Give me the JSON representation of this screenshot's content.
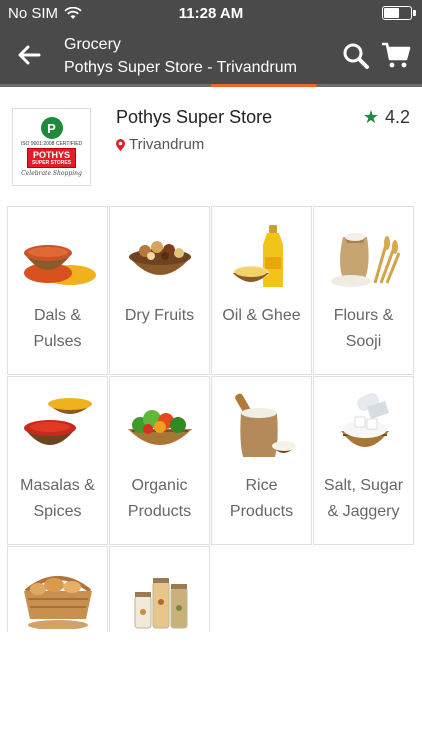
{
  "status_bar": {
    "carrier": "No SIM",
    "time": "11:28 AM"
  },
  "nav": {
    "title": "Grocery",
    "subtitle": "Pothys Super Store - Trivandrum"
  },
  "store": {
    "name": "Pothys Super Store",
    "location": "Trivandrum",
    "rating": "4.2",
    "logo": {
      "iso_text": "ISO 9001:2008 CERTIFIED",
      "brand": "POTHYS",
      "brand_sub": "SUPER STORES",
      "tagline": "Celebrate Shopping"
    }
  },
  "categories": [
    {
      "line1": "Dals &",
      "line2": "Pulses",
      "icon": "dals-icon"
    },
    {
      "line1": "Dry Fruits",
      "line2": "",
      "icon": "dry-fruits-icon"
    },
    {
      "line1": "Oil & Ghee",
      "line2": "",
      "icon": "oil-ghee-icon"
    },
    {
      "line1": "Flours &",
      "line2": "Sooji",
      "icon": "flour-icon"
    },
    {
      "line1": "Masalas &",
      "line2": "Spices",
      "icon": "masala-icon"
    },
    {
      "line1": "Organic",
      "line2": "Products",
      "icon": "organic-icon"
    },
    {
      "line1": "Rice",
      "line2": "Products",
      "icon": "rice-icon"
    },
    {
      "line1": "Salt, Sugar",
      "line2": "& Jaggery",
      "icon": "salt-sugar-icon"
    },
    {
      "line1": "",
      "line2": "",
      "icon": "bakery-icon"
    },
    {
      "line1": "",
      "line2": "",
      "icon": "jars-icon"
    }
  ],
  "colors": {
    "header_bg": "#4a4a4a",
    "accent": "#e8662b",
    "rating_star": "#1e8a3c"
  }
}
